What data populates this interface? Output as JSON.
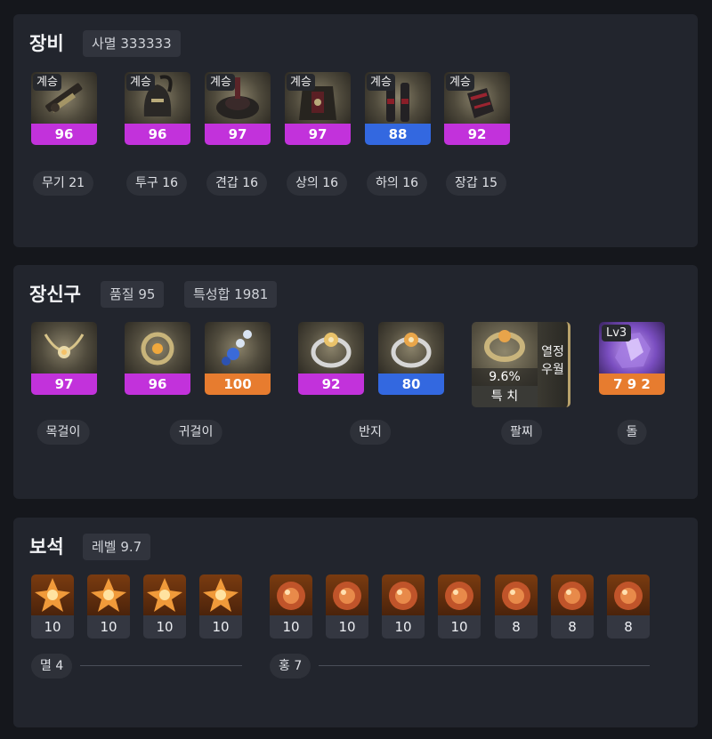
{
  "equipment": {
    "title": "장비",
    "summary": "사멸 333333",
    "items": [
      {
        "tag": "계승",
        "quality": "96",
        "quality_tier": "purple",
        "label": "무기 21",
        "icon": "weapon-icon"
      },
      {
        "tag": "계승",
        "quality": "96",
        "quality_tier": "purple",
        "label": "투구 16",
        "icon": "helmet-icon"
      },
      {
        "tag": "계승",
        "quality": "97",
        "quality_tier": "purple",
        "label": "견갑 16",
        "icon": "shoulder-icon"
      },
      {
        "tag": "계승",
        "quality": "97",
        "quality_tier": "purple",
        "label": "상의 16",
        "icon": "chest-armor-icon"
      },
      {
        "tag": "계승",
        "quality": "88",
        "quality_tier": "blue",
        "label": "하의 16",
        "icon": "leg-armor-icon"
      },
      {
        "tag": "계승",
        "quality": "92",
        "quality_tier": "purple",
        "label": "장갑 15",
        "icon": "gloves-icon"
      }
    ]
  },
  "accessories": {
    "title": "장신구",
    "quality_chip": "품질 95",
    "stats_chip": "특성합 1981",
    "necklace": {
      "quality": "97",
      "label": "목걸이",
      "icon": "necklace-icon"
    },
    "earrings": [
      {
        "quality": "96",
        "icon": "earring-icon"
      },
      {
        "quality": "100",
        "icon": "earring-icon"
      }
    ],
    "earrings_label": "귀걸이",
    "rings": [
      {
        "quality": "92",
        "icon": "ring-icon"
      },
      {
        "quality": "80",
        "icon": "ring-icon"
      }
    ],
    "rings_label": "반지",
    "bracelet": {
      "stat_value": "9.6%",
      "stat_name": "특 치",
      "side_line1": "열정",
      "side_line2": "우월",
      "label": "팔찌",
      "icon": "bracelet-icon"
    },
    "stone": {
      "level": "Lv3",
      "value": "7 9 2",
      "label": "돌",
      "icon": "ability-stone-icon"
    }
  },
  "gems": {
    "title": "보석",
    "level_chip": "레벨 9.7",
    "damage_group": {
      "label": "멸 4",
      "values": [
        "10",
        "10",
        "10",
        "10"
      ]
    },
    "cooldown_group": {
      "label": "홍 7",
      "values": [
        "10",
        "10",
        "10",
        "10",
        "8",
        "8",
        "8"
      ]
    },
    "colors": {
      "purple": "#c232db",
      "blue": "#3368e0",
      "orange": "#e77c2f"
    }
  }
}
